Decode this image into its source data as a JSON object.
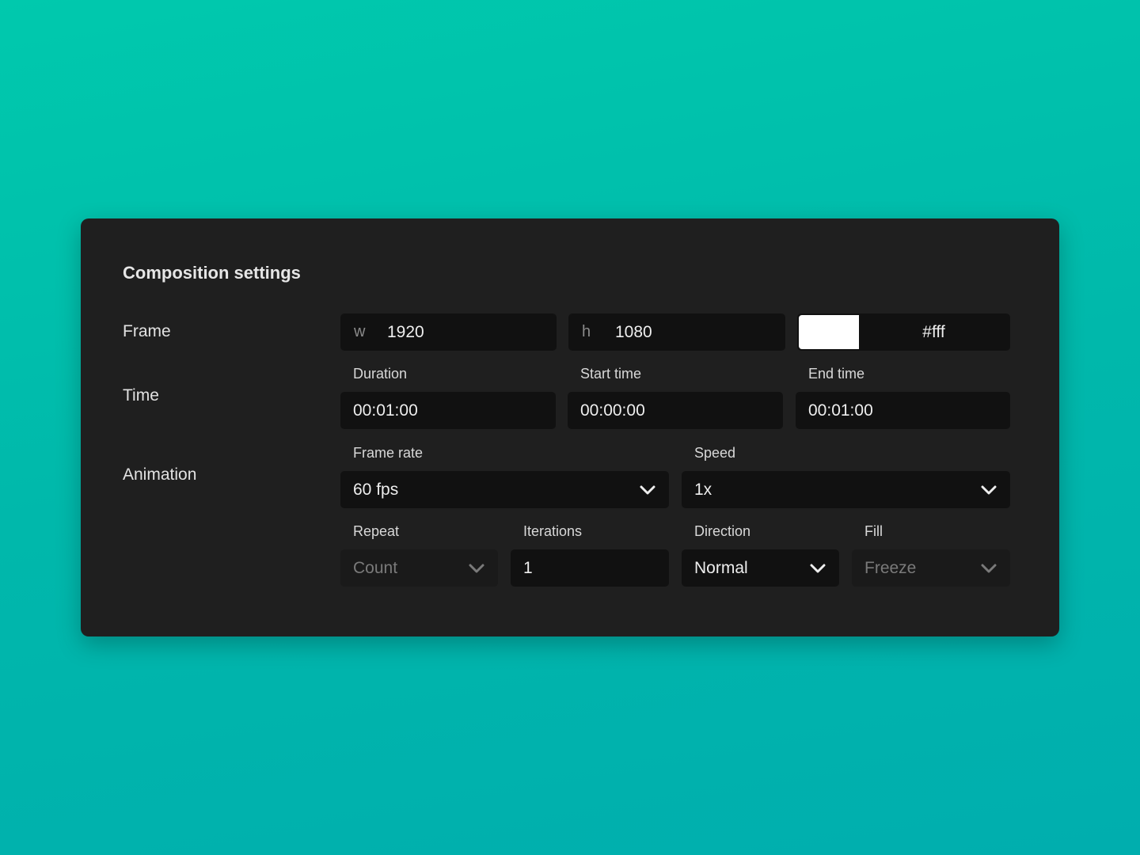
{
  "panel": {
    "title": "Composition settings"
  },
  "frame": {
    "label": "Frame",
    "width_prefix": "w",
    "width_value": "1920",
    "height_prefix": "h",
    "height_value": "1080",
    "color_value": "#fff",
    "swatch_color": "#ffffff"
  },
  "time": {
    "label": "Time",
    "duration_label": "Duration",
    "duration_value": "00:01:00",
    "start_label": "Start time",
    "start_value": "00:00:00",
    "end_label": "End time",
    "end_value": "00:01:00"
  },
  "animation": {
    "label": "Animation",
    "frame_rate_label": "Frame rate",
    "frame_rate_value": "60 fps",
    "speed_label": "Speed",
    "speed_value": "1x",
    "repeat_label": "Repeat",
    "repeat_value": "Count",
    "iterations_label": "Iterations",
    "iterations_value": "1",
    "direction_label": "Direction",
    "direction_value": "Normal",
    "fill_label": "Fill",
    "fill_value": "Freeze"
  },
  "colors": {
    "background_top": "#00c9ad",
    "background_bottom": "#00aeae",
    "panel": "#1f1f1f",
    "field": "#111111"
  },
  "icons": {
    "dropdown": "chevron-down-icon"
  }
}
